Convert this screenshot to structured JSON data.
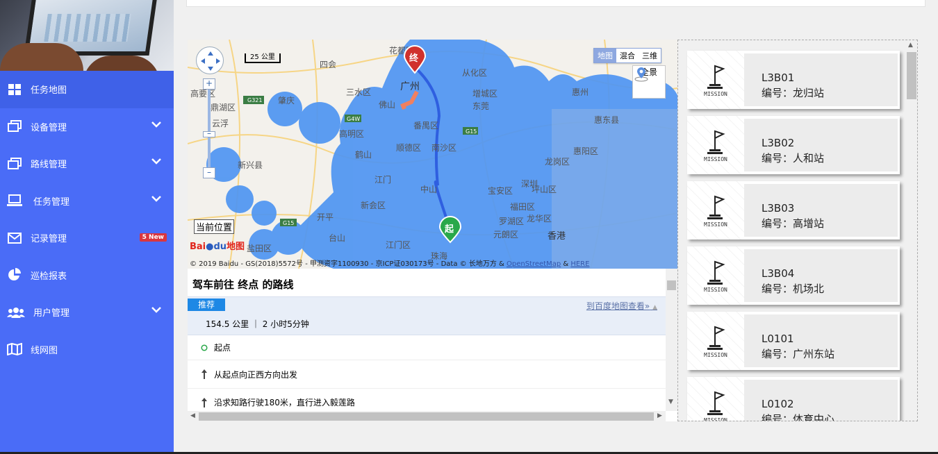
{
  "sidebar": {
    "items": [
      {
        "label": "任务地图",
        "icon": "grid-icon",
        "active": true
      },
      {
        "label": "设备管理",
        "icon": "windows-icon",
        "chevron": true
      },
      {
        "label": "路线管理",
        "icon": "windows-icon",
        "chevron": true
      },
      {
        "label": "任务管理",
        "icon": "laptop-icon",
        "chevron": true
      },
      {
        "label": "记录管理",
        "icon": "envelope-icon",
        "badge": "5 New"
      },
      {
        "label": "巡检报表",
        "icon": "pie-chart-icon"
      },
      {
        "label": "用户管理",
        "icon": "users-icon",
        "chevron": true
      },
      {
        "label": "线网图",
        "icon": "map-icon"
      }
    ]
  },
  "map": {
    "type_buttons": [
      "地图",
      "混合",
      "三维"
    ],
    "selected_type": "地图",
    "panorama_label": "全景",
    "scale_label": "25 公里",
    "current_position_label": "当前位置",
    "logo_text_baidu": "Bai",
    "logo_text_du": "du",
    "logo_text_map": "地图",
    "copyright_text": "© 2019 Baidu - GS(2018)5572号 - 甲测资字1100930 - 京ICP证030173号 - Data © 长地万方 & ",
    "copyright_link1": "OpenStreetMap",
    "copyright_amp": " & ",
    "copyright_link2": "HERE",
    "place_labels": [
      "花都区",
      "四会",
      "从化区",
      "肇庆",
      "广州",
      "增城区",
      "鼎湖区",
      "三水区",
      "惠州",
      "佛山",
      "东莞",
      "惠东县",
      "高明区",
      "番禺区",
      "顺德区",
      "南沙区",
      "惠阳区",
      "鹤山",
      "云浮",
      "新兴县",
      "江门",
      "中山",
      "宝安区",
      "深圳",
      "龙岗区",
      "坪山区",
      "新会区",
      "开平",
      "台山",
      "江门区",
      "福田区",
      "元朗区",
      "香港",
      "珠海",
      "龙华区",
      "罗湖区",
      "高要区",
      "盐田区"
    ],
    "marker_start": "起",
    "marker_end": "终",
    "road_shields": [
      "G321",
      "G4W",
      "G15",
      "G15"
    ],
    "accent_color": "#5b9cf3"
  },
  "route": {
    "title": "驾车前往 终点 的路线",
    "recommend_tab": "推荐",
    "baidu_link": "到百度地图查看»",
    "summary": "154.5 公里 ｜ 2 小时5分钟",
    "steps": [
      {
        "icon": "start-circle-icon",
        "text": "起点"
      },
      {
        "icon": "arrow-up-icon",
        "text": "从起点向正西方向出发"
      },
      {
        "icon": "arrow-up-icon",
        "text": "沿求知路行驶180米，直行进入毅莲路"
      }
    ]
  },
  "missions": [
    {
      "code": "L3B01",
      "number_label": "编号：龙归站"
    },
    {
      "code": "L3B02",
      "number_label": "编号：人和站"
    },
    {
      "code": "L3B03",
      "number_label": "编号：高增站"
    },
    {
      "code": "L3B04",
      "number_label": "编号：机场北"
    },
    {
      "code": "L0101",
      "number_label": "编号：广州东站"
    },
    {
      "code": "L0102",
      "number_label": "编号：体育中心"
    }
  ],
  "mission_icon_caption": "MISSION",
  "colors": {
    "sidebar": "#4a6cf7",
    "badge": "#d9363e",
    "route_line": "#2f5fe0"
  }
}
